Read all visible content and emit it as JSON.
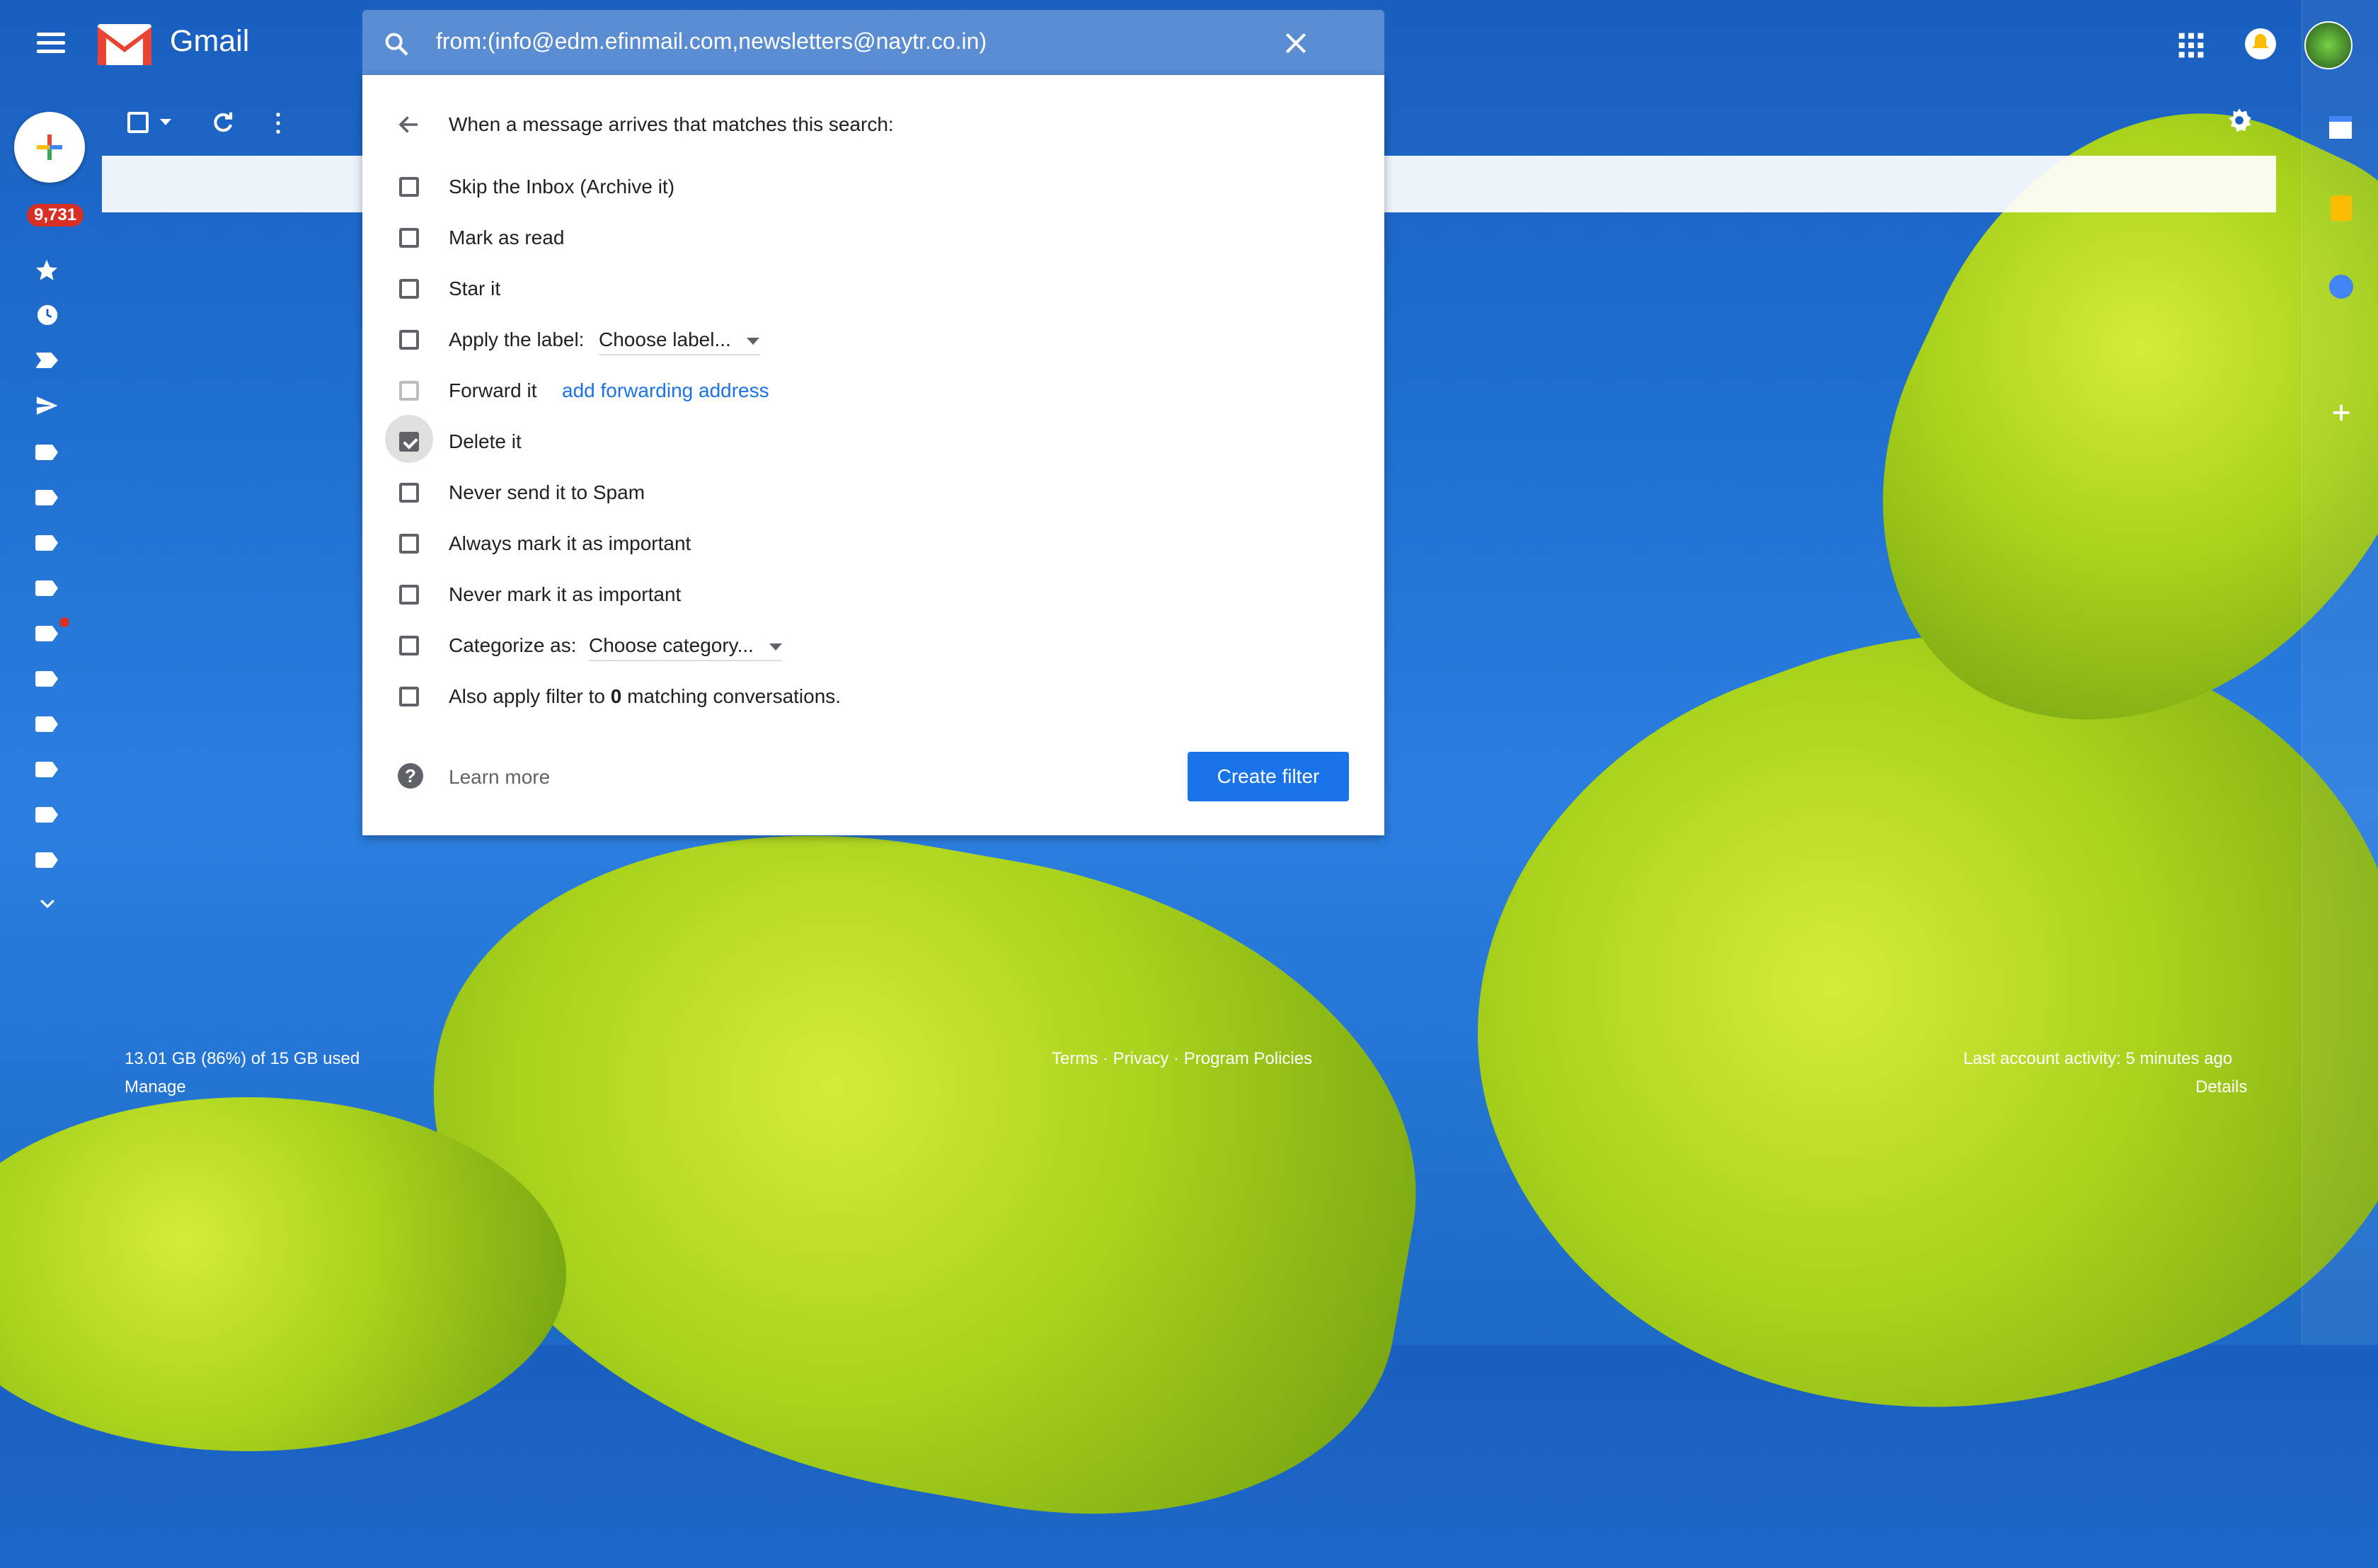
{
  "app": {
    "title": "Gmail"
  },
  "badge": {
    "count": "9,731"
  },
  "search": {
    "query": "from:(info@edm.efinmail.com,newsletters@naytr.co.in)"
  },
  "filter": {
    "header": "When a message arrives that matches this search:",
    "options": [
      {
        "label": "Skip the Inbox (Archive it)",
        "checked": false
      },
      {
        "label": "Mark as read",
        "checked": false
      },
      {
        "label": "Star it",
        "checked": false
      },
      {
        "label": "Apply the label:",
        "checked": false
      },
      {
        "label": "Forward it",
        "checked": false
      },
      {
        "label": "Delete it",
        "checked": true
      },
      {
        "label": "Never send it to Spam",
        "checked": false
      },
      {
        "label": "Always mark it as important",
        "checked": false
      },
      {
        "label": "Never mark it as important",
        "checked": false
      },
      {
        "label": "Categorize as:",
        "checked": false
      },
      {
        "label": "Also apply filter to 0 matching conversations.",
        "checked": false
      }
    ],
    "apply_label_select": "Choose label...",
    "forward_link": "add forwarding address",
    "category_select": "Choose category...",
    "apply_prefix": "Also apply filter to",
    "apply_count": "0",
    "apply_suffix": "matching conversations.",
    "learn_more": "Learn more",
    "create_button": "Create filter"
  },
  "footer": {
    "storage": "13.01 GB (86%) of 15 GB used",
    "manage": "Manage",
    "terms": "Terms",
    "privacy": "Privacy",
    "policies": "Program Policies",
    "activity": "Last account activity: 5 minutes ago",
    "details": "Details"
  },
  "colors": {
    "accent": "#1a73e8",
    "badge": "#d93025"
  }
}
